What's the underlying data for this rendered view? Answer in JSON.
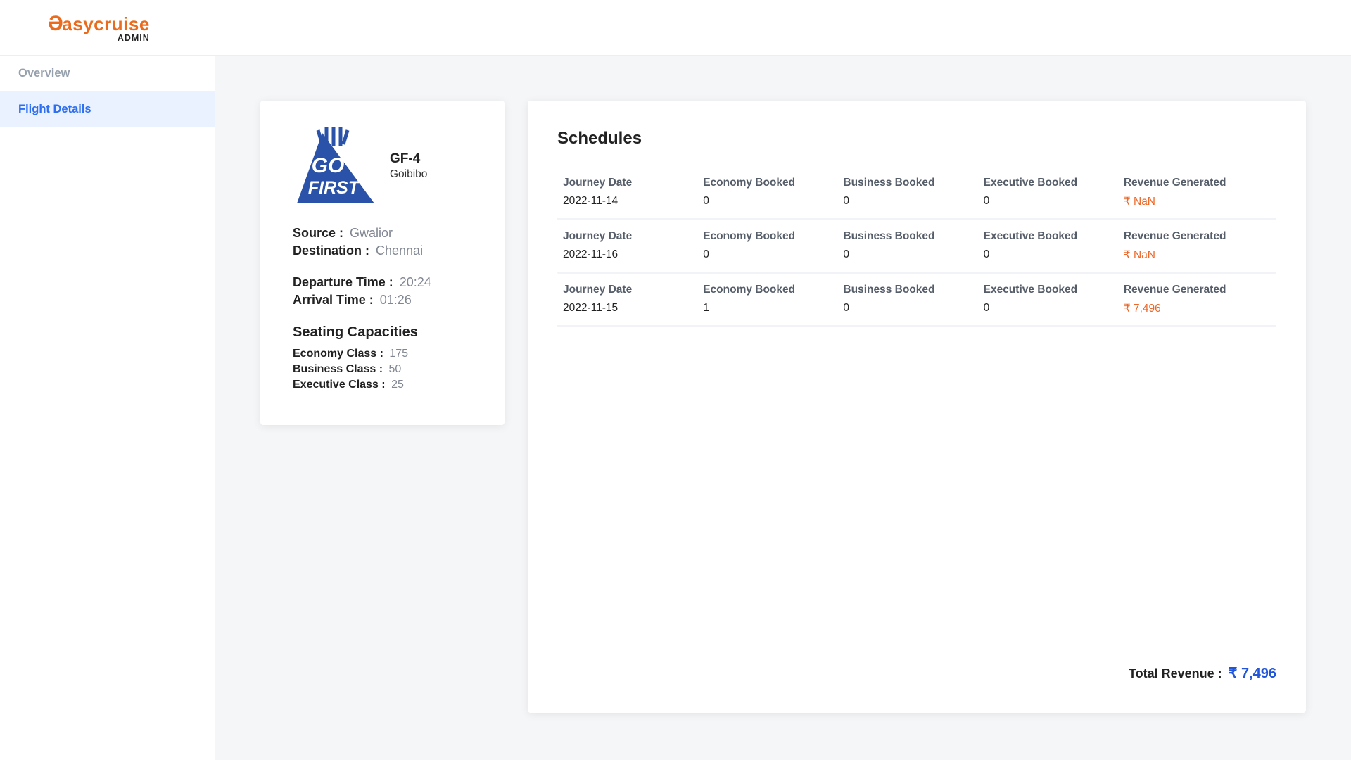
{
  "brand": {
    "name_primary": "asycruise",
    "mark": "Ə",
    "subtitle": "ADMIN"
  },
  "sidebar": {
    "items": [
      {
        "label": "Overview",
        "active": false
      },
      {
        "label": "Flight Details",
        "active": true
      }
    ]
  },
  "flight": {
    "id": "GF-4",
    "airline": "Goibibo",
    "logo_text_top": "GO",
    "logo_text_bottom": "FIRST",
    "source_label": "Source : ",
    "source": "Gwalior",
    "destination_label": "Destination : ",
    "destination": "Chennai",
    "dep_label": "Departure Time : ",
    "dep_time": "20:24",
    "arr_label": "Arrival Time : ",
    "arr_time": "01:26",
    "cap_title": "Seating Capacities",
    "eco_label": "Economy Class : ",
    "eco": "175",
    "biz_label": "Business Class : ",
    "biz": "50",
    "exe_label": "Executive Class : ",
    "exe": "25"
  },
  "schedules": {
    "title": "Schedules",
    "headers": {
      "journey": "Journey Date",
      "economy": "Economy Booked",
      "business": "Business Booked",
      "executive": "Executive Booked",
      "revenue": "Revenue Generated"
    },
    "rows": [
      {
        "date": "2022-11-14",
        "eco": "0",
        "biz": "0",
        "exe": "0",
        "rev": "₹ NaN"
      },
      {
        "date": "2022-11-16",
        "eco": "0",
        "biz": "0",
        "exe": "0",
        "rev": "₹ NaN"
      },
      {
        "date": "2022-11-15",
        "eco": "1",
        "biz": "0",
        "exe": "0",
        "rev": "₹ 7,496"
      }
    ],
    "total_label": "Total Revenue : ",
    "total_value": "₹ 7,496"
  }
}
